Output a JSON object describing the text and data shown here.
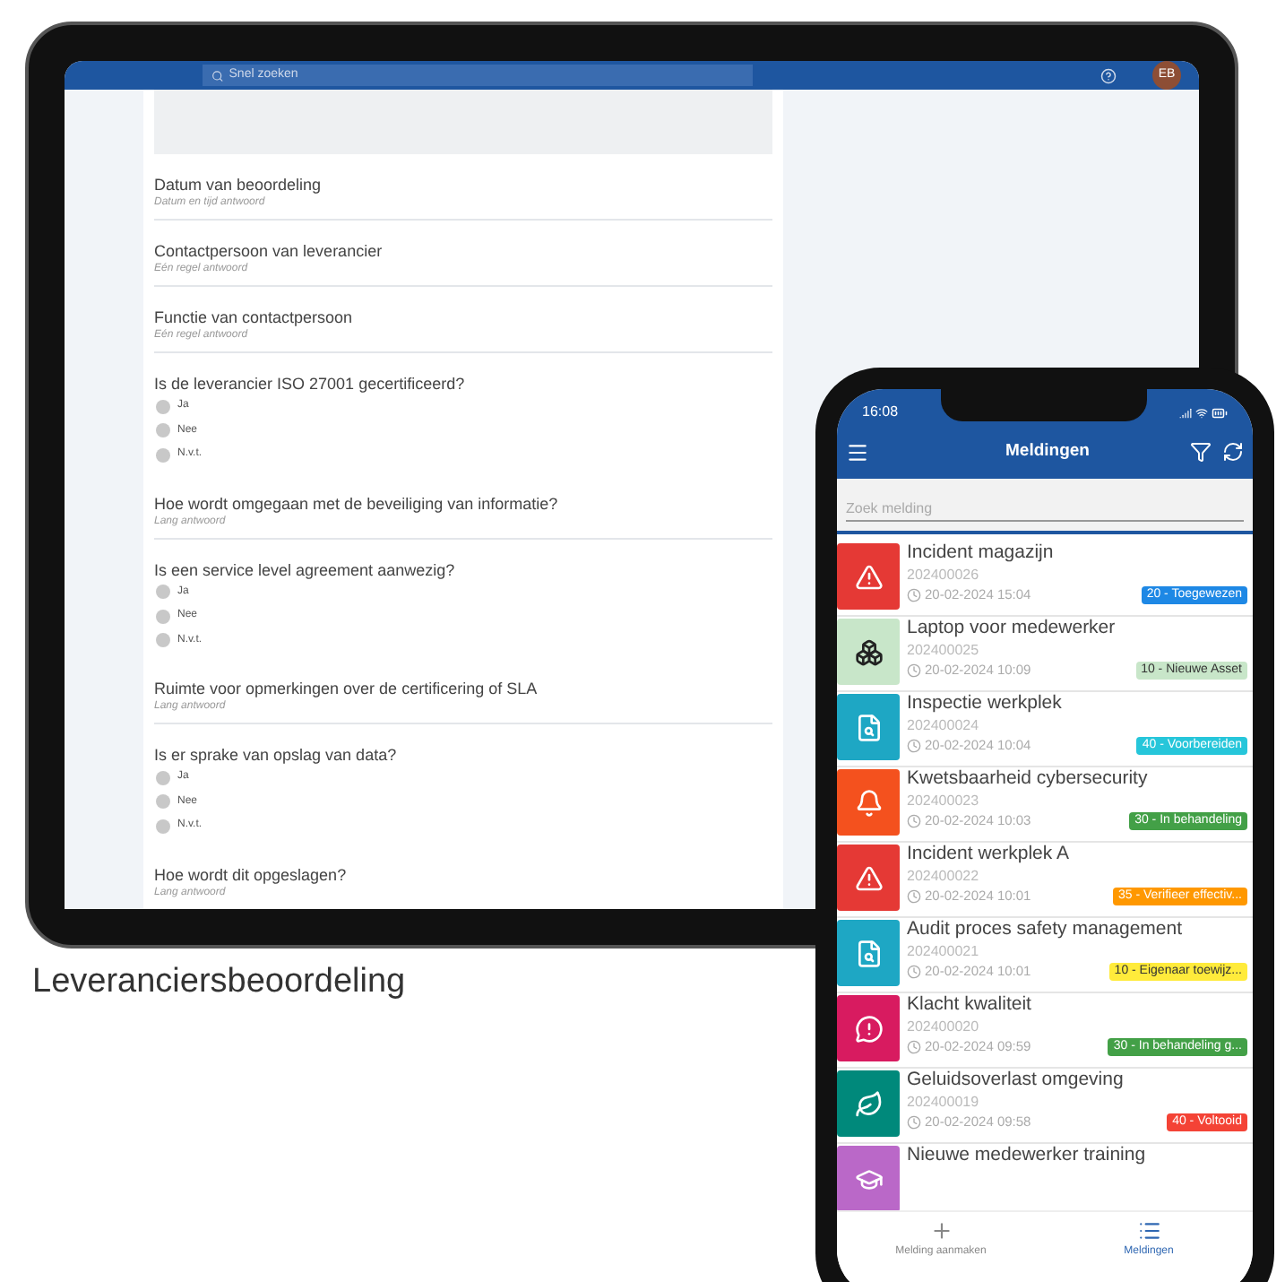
{
  "tablet": {
    "search": {
      "placeholder": "Snel zoeken"
    },
    "avatar": "EB",
    "form": [
      {
        "kind": "text",
        "label": "Datum van beoordeling",
        "hint": "Datum en tijd antwoord"
      },
      {
        "kind": "text",
        "label": "Contactpersoon van leverancier",
        "hint": "Eén regel antwoord"
      },
      {
        "kind": "text",
        "label": "Functie van contactpersoon",
        "hint": "Eén regel antwoord"
      },
      {
        "kind": "radio",
        "label": "Is de leverancier ISO 27001 gecertificeerd?",
        "options": [
          {
            "label": "Ja",
            "selected": false
          },
          {
            "label": "Nee",
            "selected": false
          },
          {
            "label": "N.v.t.",
            "selected": false
          }
        ]
      },
      {
        "kind": "text",
        "label": "Hoe wordt omgegaan met de beveiliging van informatie?",
        "hint": "Lang antwoord"
      },
      {
        "kind": "radio",
        "label": "Is een service level agreement aanwezig?",
        "options": [
          {
            "label": "Ja",
            "selected": false
          },
          {
            "label": "Nee",
            "selected": false
          },
          {
            "label": "N.v.t.",
            "selected": false
          }
        ]
      },
      {
        "kind": "text",
        "label": "Ruimte voor opmerkingen over de certificering of SLA",
        "hint": "Lang antwoord"
      },
      {
        "kind": "radio",
        "label": "Is er sprake van opslag van data?",
        "options": [
          {
            "label": "Ja",
            "selected": false
          },
          {
            "label": "Nee",
            "selected": false
          },
          {
            "label": "N.v.t.",
            "selected": false
          }
        ]
      },
      {
        "kind": "text",
        "label": "Hoe wordt dit opgeslagen?",
        "hint": "Lang antwoord"
      }
    ]
  },
  "caption": "Leveranciersbeoordeling",
  "phone": {
    "time": "16:08",
    "title": "Meldingen",
    "search": {
      "placeholder": "Zoek melding"
    },
    "items": [
      {
        "kind": "warning",
        "title": "Incident magazijn",
        "number": "202400026",
        "date": "20-02-2024 15:04",
        "status": {
          "label": "20 - Toegewezen",
          "color": "#1e88e5"
        }
      },
      {
        "kind": "asset",
        "title": "Laptop voor medewerker",
        "number": "202400025",
        "date": "20-02-2024 10:09",
        "status": {
          "label": "10 - Nieuwe Asset",
          "color": "#c8e6c9"
        }
      },
      {
        "kind": "inspection",
        "title": "Inspectie werkplek",
        "number": "202400024",
        "date": "20-02-2024 10:04",
        "status": {
          "label": "40 - Voorbereiden",
          "color": "#26c6da"
        }
      },
      {
        "kind": "alarm",
        "title": "Kwetsbaarheid cybersecurity",
        "number": "202400023",
        "date": "20-02-2024 10:03",
        "status": {
          "label": "30 - In behandeling",
          "color": "#43a047"
        }
      },
      {
        "kind": "warning",
        "title": "Incident werkplek A",
        "number": "202400022",
        "date": "20-02-2024 10:01",
        "status": {
          "label": "35 - Verifieer effectiv...",
          "color": "#ff9800"
        }
      },
      {
        "kind": "inspection",
        "title": "Audit proces safety management",
        "number": "202400021",
        "date": "20-02-2024 10:01",
        "status": {
          "label": "10 - Eigenaar toewijz...",
          "color": "#ffeb3b"
        }
      },
      {
        "kind": "complaint",
        "title": "Klacht kwaliteit",
        "number": "202400020",
        "date": "20-02-2024 09:59",
        "status": {
          "label": "30 - In behandeling g...",
          "color": "#43a047"
        }
      },
      {
        "kind": "environment",
        "title": "Geluidsoverlast omgeving",
        "number": "202400019",
        "date": "20-02-2024 09:58",
        "status": {
          "label": "40 - Voltooid",
          "color": "#f44336"
        }
      },
      {
        "kind": "training",
        "title": "Nieuwe medewerker training"
      }
    ],
    "nav": [
      {
        "kind": "create",
        "label": "Melding aanmaken",
        "selected": false
      },
      {
        "kind": "list",
        "label": "Meldingen",
        "selected": true
      }
    ]
  }
}
